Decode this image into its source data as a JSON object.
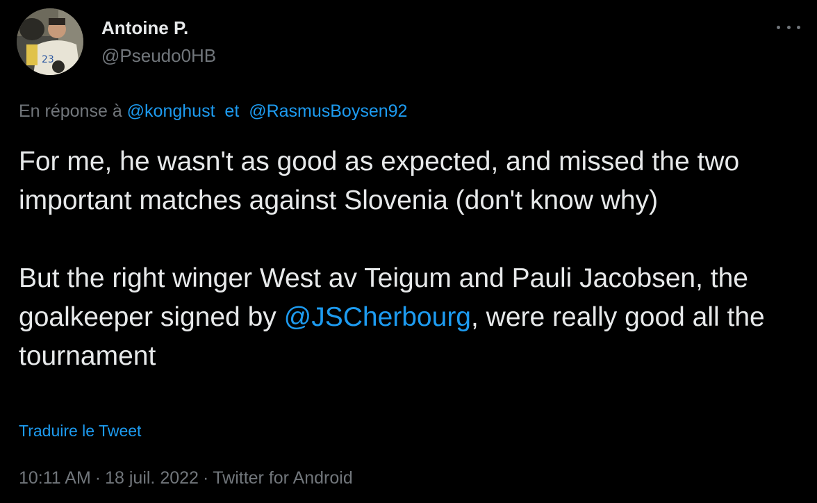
{
  "author": {
    "display_name": "Antoine P.",
    "handle": "@Pseudo0HB",
    "avatar": "avatar-photo-handball-player"
  },
  "more_icon": "more-horizontal-icon",
  "reply": {
    "prefix": "En réponse à",
    "mention1": "@konghust",
    "joiner": "et",
    "mention2": "@RasmusBoysen92"
  },
  "body": {
    "paragraph1": "For me, he wasn't as good as expected, and missed the two important matches against Slovenia (don't know why)",
    "paragraph2_before": "But the right winger West av Teigum and Pauli Jacobsen, the goalkeeper signed by ",
    "paragraph2_mention": "@JSCherbourg",
    "paragraph2_after": ", were really good all the tournament"
  },
  "translate_label": "Traduire le Tweet",
  "meta": {
    "time": "10:11 AM",
    "separator": "·",
    "date": "18 juil. 2022",
    "source": "Twitter for Android"
  },
  "colors": {
    "background": "#000000",
    "text": "#e7e9ea",
    "secondary": "#71767b",
    "link": "#1d9bf0"
  }
}
